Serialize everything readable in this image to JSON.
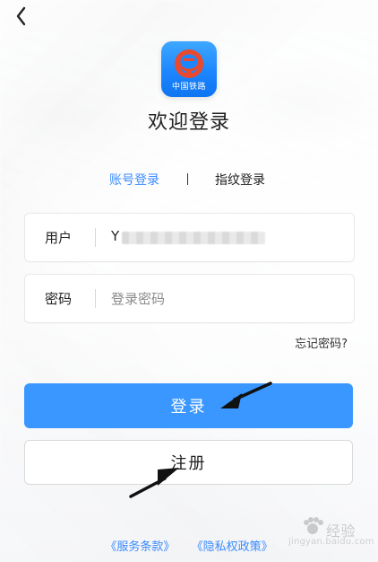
{
  "header": {
    "back_icon": "chevron-left-icon"
  },
  "brand": {
    "logo_text": "中国铁路"
  },
  "page": {
    "title": "欢迎登录"
  },
  "tabs": [
    {
      "label": "账号登录"
    },
    {
      "label": "指纹登录"
    }
  ],
  "fields": {
    "user": {
      "label": "用户",
      "value": "Y"
    },
    "password": {
      "label": "密码",
      "placeholder": "登录密码"
    }
  },
  "links": {
    "forgot": "忘记密码?"
  },
  "buttons": {
    "login": "登录",
    "register": "注册"
  },
  "policy": {
    "terms": "《服务条款》",
    "privacy": "《隐私权政策》"
  },
  "watermark": {
    "text": "经验",
    "sub": "jingyan.baidu.com"
  },
  "colors": {
    "accent": "#3b8bff",
    "login_button": "#3a97ff"
  }
}
